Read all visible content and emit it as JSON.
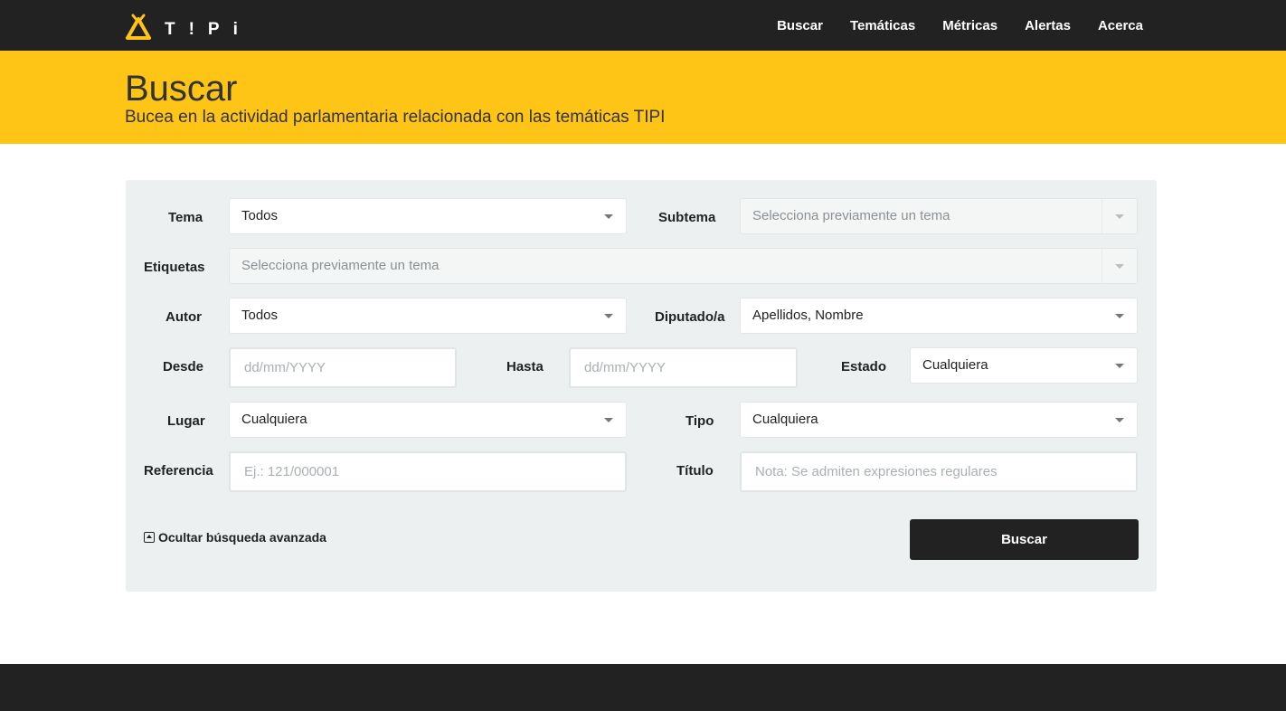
{
  "brand": {
    "logo_text": "T!Pi"
  },
  "nav": {
    "items": [
      "Buscar",
      "Temáticas",
      "Métricas",
      "Alertas",
      "Acerca"
    ]
  },
  "hero": {
    "title": "Buscar",
    "subtitle": "Bucea en la actividad parlamentaria relacionada con las temáticas TIPI"
  },
  "form": {
    "tema": {
      "label": "Tema",
      "value": "Todos"
    },
    "subtema": {
      "label": "Subtema",
      "value": "Selecciona previamente un tema"
    },
    "etiquetas": {
      "label": "Etiquetas",
      "value": "Selecciona previamente un tema"
    },
    "autor": {
      "label": "Autor",
      "value": "Todos"
    },
    "diputado": {
      "label": "Diputado/a",
      "value": "Apellidos, Nombre"
    },
    "desde": {
      "label": "Desde",
      "placeholder": "dd/mm/YYYY"
    },
    "hasta": {
      "label": "Hasta",
      "placeholder": "dd/mm/YYYY"
    },
    "estado": {
      "label": "Estado",
      "value": "Cualquiera"
    },
    "lugar": {
      "label": "Lugar",
      "value": "Cualquiera"
    },
    "tipo": {
      "label": "Tipo",
      "value": "Cualquiera"
    },
    "referencia": {
      "label": "Referencia",
      "placeholder": "Ej.: 121/000001"
    },
    "titulo": {
      "label": "Título",
      "placeholder": "Nota: Se admiten expresiones regulares"
    },
    "toggle_advanced": "Ocultar búsqueda avanzada",
    "submit": "Buscar"
  },
  "colors": {
    "accent": "#fec416",
    "dark": "#222222",
    "panel": "#ecf0f1"
  }
}
